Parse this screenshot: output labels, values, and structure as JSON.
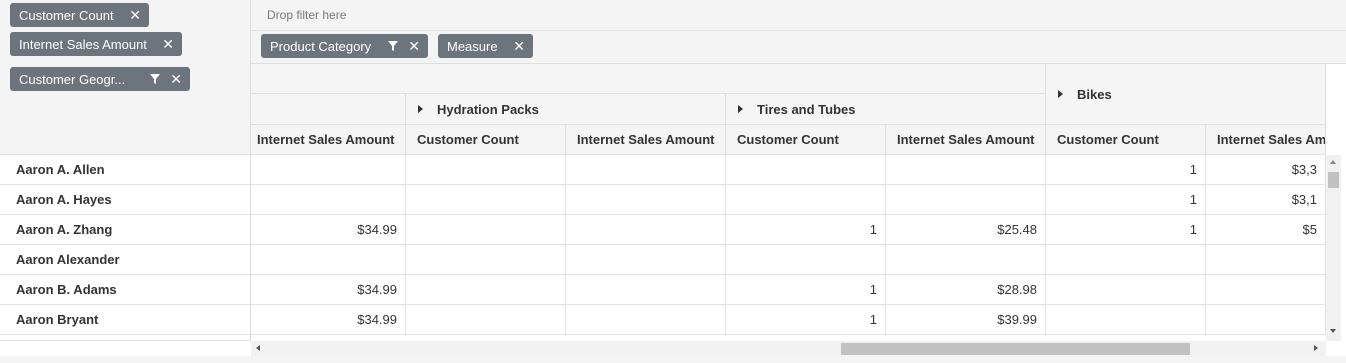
{
  "row_chips": [
    {
      "label": "Customer Count"
    },
    {
      "label": "Internet Sales Amount"
    },
    {
      "label": "Customer Geogr..."
    }
  ],
  "filter_zone": {
    "placeholder": "Drop filter here"
  },
  "column_chips": [
    {
      "label": "Product Category"
    },
    {
      "label": "Measure"
    }
  ],
  "remove_symbol": "✕",
  "groups": [
    "Hydration Packs",
    "Tires and Tubes",
    "Bikes"
  ],
  "measures": [
    "Internet Sales Amount",
    "Customer Count",
    "Internet Sales Amount",
    "Customer Count",
    "Internet Sales Amount",
    "Customer Count",
    "Internet Sales Am"
  ],
  "rows": [
    {
      "name": "Aaron A. Allen",
      "cells": [
        "",
        "",
        "",
        "",
        "",
        "1",
        "$3,3"
      ]
    },
    {
      "name": "Aaron A. Hayes",
      "cells": [
        "",
        "",
        "",
        "",
        "",
        "1",
        "$3,1"
      ]
    },
    {
      "name": "Aaron A. Zhang",
      "cells": [
        "$34.99",
        "",
        "",
        "1",
        "$25.48",
        "1",
        "$5"
      ]
    },
    {
      "name": "Aaron Alexander",
      "cells": [
        "",
        "",
        "",
        "",
        "",
        "",
        ""
      ]
    },
    {
      "name": "Aaron B. Adams",
      "cells": [
        "$34.99",
        "",
        "",
        "1",
        "$28.98",
        "",
        ""
      ]
    },
    {
      "name": "Aaron Bryant",
      "cells": [
        "$34.99",
        "",
        "",
        "1",
        "$39.99",
        "",
        ""
      ]
    }
  ],
  "colors": {
    "chip": "#6c757d",
    "header_bg": "#f5f5f5",
    "grid": "#e3e3e3"
  }
}
